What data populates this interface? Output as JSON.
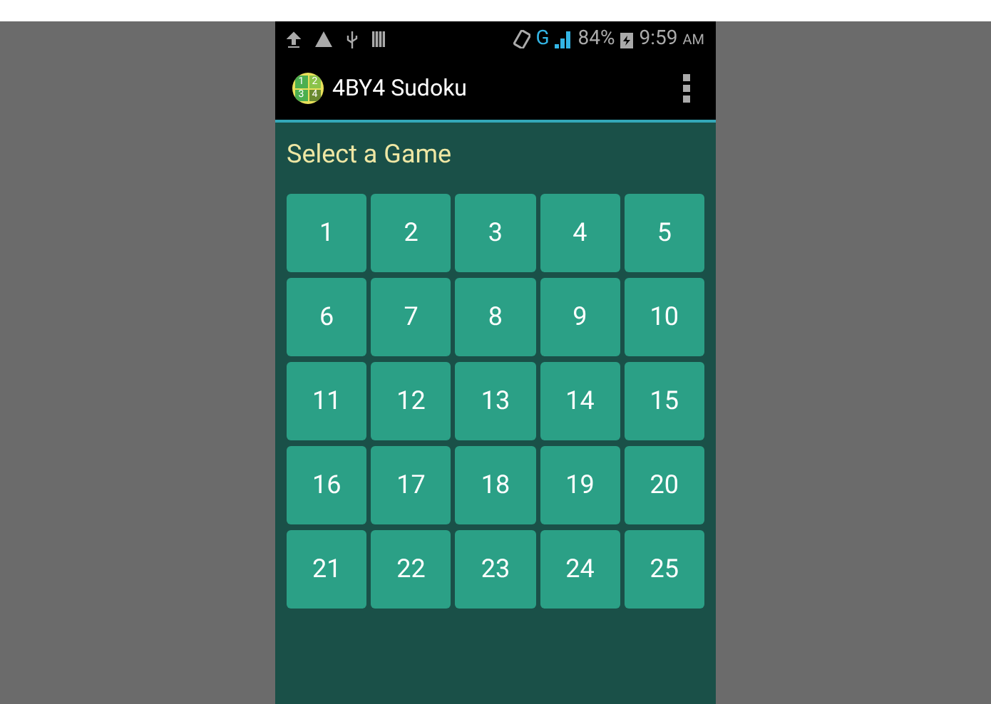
{
  "status_bar": {
    "network": "G",
    "battery": "84%",
    "time": "9:59",
    "time_suffix": "AM"
  },
  "app_bar": {
    "logo_digits": [
      "1",
      "2",
      "3",
      "4"
    ],
    "title": "4BY4 Sudoku"
  },
  "heading": "Select a Game",
  "games": [
    "1",
    "2",
    "3",
    "4",
    "5",
    "6",
    "7",
    "8",
    "9",
    "10",
    "11",
    "12",
    "13",
    "14",
    "15",
    "16",
    "17",
    "18",
    "19",
    "20",
    "21",
    "22",
    "23",
    "24",
    "25"
  ]
}
